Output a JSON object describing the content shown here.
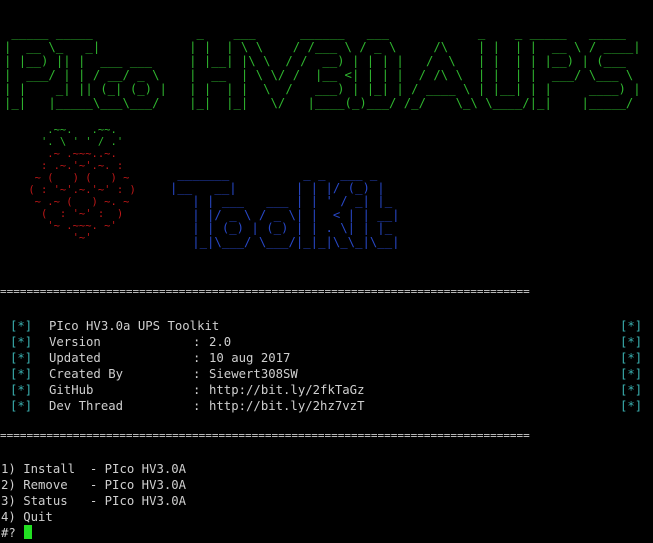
{
  "terminal": {
    "background": "#000000",
    "foreground": "#cfcfcf"
  },
  "banner": {
    "text": "PIco HV3.0A UPS",
    "color": "#2fb52f"
  },
  "logo": {
    "text": "Toolkit",
    "color": "#2848c8",
    "icon": "raspberry-pi-icon",
    "leaf_color": "#2fb52f",
    "berry_color": "#c01818"
  },
  "separator": "================================================================================",
  "info": {
    "tag": "[*]",
    "tag_color": "#3ab0b0",
    "title": "PIco HV3.0a UPS Toolkit",
    "rows": [
      {
        "label": "Version",
        "value": "2.0"
      },
      {
        "label": "Updated",
        "value": "10 aug 2017"
      },
      {
        "label": "Created By",
        "value": "Siewert308SW"
      },
      {
        "label": "GitHub",
        "value": "http://bit.ly/2fkTaGz"
      },
      {
        "label": "Dev Thread",
        "value": "http://bit.ly/2hz7vzT"
      }
    ]
  },
  "menu": {
    "items": [
      "1) Install  - PIco HV3.0A",
      "2) Remove   - PIco HV3.0A",
      "3) Status   - PIco HV3.0A",
      "4) Quit"
    ],
    "prompt": "#?",
    "cursor_color": "#22e022"
  }
}
